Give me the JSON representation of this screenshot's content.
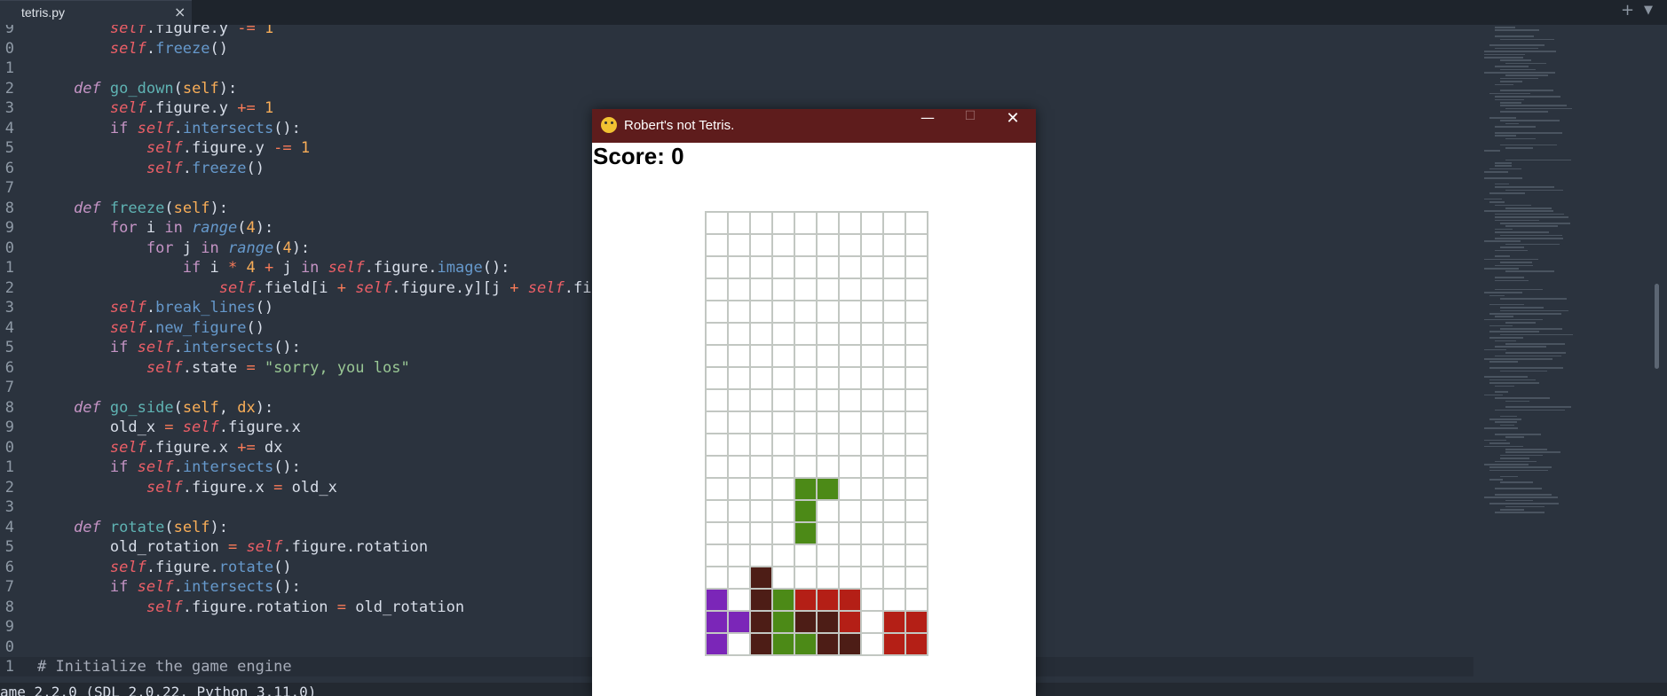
{
  "editor": {
    "tab": {
      "label": "tetris.py",
      "close": "×"
    },
    "tabbar_right": {
      "add": "+",
      "menu": "▼"
    },
    "lines": [
      {
        "n": "9",
        "html": "        <span class='slf'>self</span>.figure.y <span class='op'>-=</span> <span class='num'>1</span>"
      },
      {
        "n": "0",
        "html": "        <span class='slf'>self</span>.<span class='meth'>freeze</span>()"
      },
      {
        "n": "1",
        "html": ""
      },
      {
        "n": "2",
        "html": "    <span class='kw'>def</span> <span class='fn'>go_down</span>(<span class='prm'>self</span>):"
      },
      {
        "n": "3",
        "html": "        <span class='slf'>self</span>.figure.y <span class='op'>+=</span> <span class='num'>1</span>"
      },
      {
        "n": "4",
        "html": "        <span class='kwn'>if</span> <span class='slf'>self</span>.<span class='meth'>intersects</span>():"
      },
      {
        "n": "5",
        "html": "            <span class='slf'>self</span>.figure.y <span class='op'>-=</span> <span class='num'>1</span>"
      },
      {
        "n": "6",
        "html": "            <span class='slf'>self</span>.<span class='meth'>freeze</span>()"
      },
      {
        "n": "7",
        "html": ""
      },
      {
        "n": "8",
        "html": "    <span class='kw'>def</span> <span class='fn'>freeze</span>(<span class='prm'>self</span>):"
      },
      {
        "n": "9",
        "html": "        <span class='kwn'>for</span> i <span class='kwn'>in</span> <span class='bi'>range</span>(<span class='num'>4</span>):"
      },
      {
        "n": "0",
        "html": "            <span class='kwn'>for</span> j <span class='kwn'>in</span> <span class='bi'>range</span>(<span class='num'>4</span>):"
      },
      {
        "n": "1",
        "html": "                <span class='kwn'>if</span> i <span class='op'>*</span> <span class='num'>4</span> <span class='op'>+</span> j <span class='kwn'>in</span> <span class='slf'>self</span>.figure.<span class='meth'>image</span>():"
      },
      {
        "n": "2",
        "html": "                    <span class='slf'>self</span>.field[i <span class='op'>+</span> <span class='slf'>self</span>.figure.y][j <span class='op'>+</span> <span class='slf'>self</span>.fi"
      },
      {
        "n": "3",
        "html": "        <span class='slf'>self</span>.<span class='meth'>break_lines</span>()"
      },
      {
        "n": "4",
        "html": "        <span class='slf'>self</span>.<span class='meth'>new_figure</span>()"
      },
      {
        "n": "5",
        "html": "        <span class='kwn'>if</span> <span class='slf'>self</span>.<span class='meth'>intersects</span>():"
      },
      {
        "n": "6",
        "html": "            <span class='slf'>self</span>.state <span class='op'>=</span> <span class='str'>\"sorry, you los\"</span>"
      },
      {
        "n": "7",
        "html": ""
      },
      {
        "n": "8",
        "html": "    <span class='kw'>def</span> <span class='fn'>go_side</span>(<span class='prm'>self</span>, <span class='prm'>dx</span>):"
      },
      {
        "n": "9",
        "html": "        old_x <span class='op'>=</span> <span class='slf'>self</span>.figure.x"
      },
      {
        "n": "0",
        "html": "        <span class='slf'>self</span>.figure.x <span class='op'>+=</span> dx"
      },
      {
        "n": "1",
        "html": "        <span class='kwn'>if</span> <span class='slf'>self</span>.<span class='meth'>intersects</span>():"
      },
      {
        "n": "2",
        "html": "            <span class='slf'>self</span>.figure.x <span class='op'>=</span> old_x"
      },
      {
        "n": "3",
        "html": ""
      },
      {
        "n": "4",
        "html": "    <span class='kw'>def</span> <span class='fn'>rotate</span>(<span class='prm'>self</span>):"
      },
      {
        "n": "5",
        "html": "        old_rotation <span class='op'>=</span> <span class='slf'>self</span>.figure.rotation"
      },
      {
        "n": "6",
        "html": "        <span class='slf'>self</span>.figure.<span class='meth'>rotate</span>()"
      },
      {
        "n": "7",
        "html": "        <span class='kwn'>if</span> <span class='slf'>self</span>.<span class='meth'>intersects</span>():"
      },
      {
        "n": "8",
        "html": "            <span class='slf'>self</span>.figure.rotation <span class='op'>=</span> old_rotation"
      },
      {
        "n": "9",
        "html": ""
      },
      {
        "n": "0",
        "html": ""
      },
      {
        "n": "1",
        "html": "<span class='cmt'># Initialize the game engine</span>",
        "active": true
      }
    ],
    "console_text": "ame 2.2.0 (SDL 2.0.22, Python 3.11.0)"
  },
  "game": {
    "title": "Robert's not Tetris.",
    "buttons": {
      "minimize": "—",
      "maximize": "☐",
      "close": "✕"
    },
    "score_text": "Score: 0",
    "colors": {
      "P": "#7b26b8",
      "B": "#4d1d16",
      "G": "#4c8a17",
      "R": "#b41f16",
      "grid": "#c2c7c2"
    },
    "board": [
      "..........",
      "..........",
      "..........",
      "..........",
      "..........",
      "..........",
      "..........",
      "..........",
      "..........",
      "..........",
      "..........",
      "..........",
      "....GG....",
      "....G.....",
      "....G.....",
      "..........",
      "..B.......",
      "P.BGRRR...",
      "PPBGBBR.RR",
      "P.BGGBB.RR"
    ]
  }
}
